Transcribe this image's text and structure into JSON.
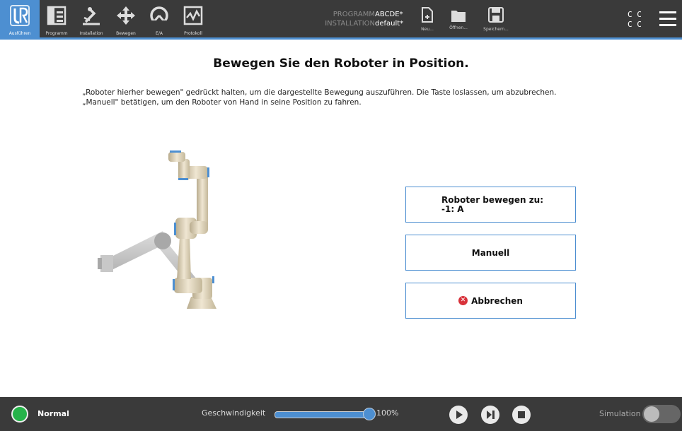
{
  "nav": {
    "tabs": [
      {
        "label": "Ausführen"
      },
      {
        "label": "Programm"
      },
      {
        "label": "Installation"
      },
      {
        "label": "Bewegen"
      },
      {
        "label": "E/A"
      },
      {
        "label": "Protokoll"
      }
    ]
  },
  "program": {
    "program_label": "PROGRAMM",
    "program_value": "ABCDE*",
    "installation_label": "INSTALLATION",
    "installation_value": "default*"
  },
  "file": {
    "new_label": "Neu...",
    "open_label": "Öffnen...",
    "save_label": "Speichern..."
  },
  "top_right": {
    "cc_line1": "C C",
    "cc_line2": "C C"
  },
  "main": {
    "title": "Bewegen Sie den Roboter in Position.",
    "instruction_line1": "„Roboter hierher bewegen\" gedrückt halten, um die dargestellte Bewegung auszuführen. Die Taste loslassen, um abzubrechen.",
    "instruction_line2": "„Manuell\" betätigen, um den Roboter von Hand in seine Position zu fahren.",
    "move_button_line1": "Roboter bewegen zu:",
    "move_button_line2": "-1: A",
    "manual_button": "Manuell",
    "cancel_button": "Abbrechen"
  },
  "footer": {
    "status": "Normal",
    "speed_label": "Geschwindigkeit",
    "speed_value": "100%",
    "speed_fraction": 1.0,
    "simulation_label": "Simulation"
  },
  "colors": {
    "accent": "#4d8fd1",
    "bar_bg": "#3a3a3a",
    "status_ok": "#26b34a",
    "cancel_red": "#d8323b"
  }
}
